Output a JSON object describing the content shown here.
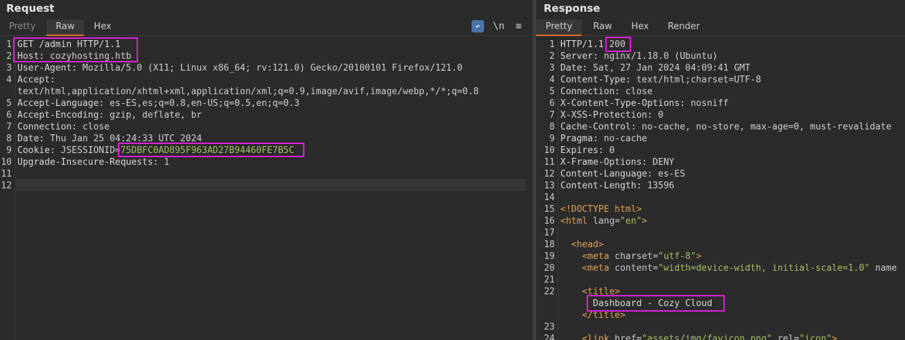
{
  "request": {
    "title": "Request",
    "tabs": [
      "Pretty",
      "Raw",
      "Hex"
    ],
    "active_tab": "Raw",
    "tools": [
      "wrap-lines",
      "\\n",
      "≡"
    ],
    "lines": [
      {
        "n": "1",
        "k": "GET /admin HTTP/1.1",
        "v": ""
      },
      {
        "n": "2",
        "k": "Host:",
        "v": " cozyhosting.htb"
      },
      {
        "n": "3",
        "k": "User-Agent:",
        "v": " Mozilla/5.0 (X11; Linux x86_64; rv:121.0) Gecko/20100101 Firefox/121.0"
      },
      {
        "n": "4",
        "k": "Accept:",
        "v": ""
      },
      {
        "n": "",
        "k": "",
        "v": "text/html,application/xhtml+xml,application/xml;q=0.9,image/avif,image/webp,*/*;q=0.8"
      },
      {
        "n": "5",
        "k": "Accept-Language:",
        "v": " es-ES,es;q=0.8,en-US;q=0.5,en;q=0.3"
      },
      {
        "n": "6",
        "k": "Accept-Encoding:",
        "v": " gzip, deflate, br"
      },
      {
        "n": "7",
        "k": "Connection:",
        "v": " close"
      },
      {
        "n": "8",
        "k": "Date:",
        "v": " Thu Jan 25 04:24:33 UTC 2024"
      },
      {
        "n": "9",
        "k": "Cookie:",
        "v": " JSESSIONID=",
        "g": "75DBFC0AD895F963AD27B94460FE7B5C"
      },
      {
        "n": "10",
        "k": "Upgrade-Insecure-Requests:",
        "v": " 1"
      },
      {
        "n": "11",
        "k": "",
        "v": ""
      },
      {
        "n": "12",
        "k": "",
        "v": ""
      }
    ]
  },
  "response": {
    "title": "Response",
    "tabs": [
      "Pretty",
      "Raw",
      "Hex",
      "Render"
    ],
    "active_tab": "Pretty",
    "headers": [
      {
        "n": "1",
        "k": "HTTP/1.1 ",
        "v": "200"
      },
      {
        "n": "2",
        "k": "Server:",
        "v": " nginx/1.18.0 (Ubuntu)"
      },
      {
        "n": "3",
        "k": "Date:",
        "v": " Sat, 27 Jan 2024 04:09:41 GMT"
      },
      {
        "n": "4",
        "k": "Content-Type:",
        "v": " text/html;charset=UTF-8"
      },
      {
        "n": "5",
        "k": "Connection:",
        "v": " close"
      },
      {
        "n": "6",
        "k": "X-Content-Type-Options:",
        "v": " nosniff"
      },
      {
        "n": "7",
        "k": "X-XSS-Protection:",
        "v": " 0"
      },
      {
        "n": "8",
        "k": "Cache-Control:",
        "v": " no-cache, no-store, max-age=0, must-revalidate"
      },
      {
        "n": "9",
        "k": "Pragma:",
        "v": " no-cache"
      },
      {
        "n": "10",
        "k": "Expires:",
        "v": " 0"
      },
      {
        "n": "11",
        "k": "X-Frame-Options:",
        "v": " DENY"
      },
      {
        "n": "12",
        "k": "Content-Language:",
        "v": " es-ES"
      },
      {
        "n": "13",
        "k": "Content-Length:",
        "v": " 13596"
      },
      {
        "n": "14",
        "k": "",
        "v": ""
      }
    ],
    "html_lines": [
      {
        "n": "15",
        "parts": [
          [
            "tag",
            "<!DOCTYPE html>"
          ]
        ]
      },
      {
        "n": "16",
        "parts": [
          [
            "tag",
            "<html "
          ],
          [
            "attr",
            "lang="
          ],
          [
            "str",
            "\"en\""
          ],
          [
            "tag",
            ">"
          ]
        ]
      },
      {
        "n": "17",
        "parts": []
      },
      {
        "n": "18",
        "parts": [
          [
            "plain",
            "  "
          ],
          [
            "tag",
            "<head>"
          ]
        ]
      },
      {
        "n": "19",
        "parts": [
          [
            "plain",
            "    "
          ],
          [
            "tag",
            "<meta "
          ],
          [
            "attr",
            "charset="
          ],
          [
            "str",
            "\"utf-8\""
          ],
          [
            "tag",
            ">"
          ]
        ]
      },
      {
        "n": "20",
        "parts": [
          [
            "plain",
            "    "
          ],
          [
            "tag",
            "<meta "
          ],
          [
            "attr",
            "content="
          ],
          [
            "str",
            "\"width=device-width, initial-scale=1.0\""
          ],
          [
            "attr",
            " name"
          ]
        ]
      },
      {
        "n": "21",
        "parts": []
      },
      {
        "n": "22",
        "parts": [
          [
            "plain",
            "    "
          ],
          [
            "tag",
            "<title>"
          ]
        ]
      },
      {
        "n": "",
        "parts": [
          [
            "plain",
            "      Dashboard - Cozy Cloud"
          ]
        ]
      },
      {
        "n": "",
        "parts": [
          [
            "plain",
            "    "
          ],
          [
            "tag",
            "</title>"
          ]
        ]
      },
      {
        "n": "23",
        "parts": []
      },
      {
        "n": "24",
        "parts": [
          [
            "plain",
            "    "
          ],
          [
            "tag",
            "<link "
          ],
          [
            "attr",
            "href="
          ],
          [
            "str",
            "\"assets/img/favicon.png\""
          ],
          [
            "attr",
            " rel="
          ],
          [
            "str",
            "\"icon\""
          ],
          [
            "tag",
            ">"
          ]
        ]
      }
    ]
  }
}
